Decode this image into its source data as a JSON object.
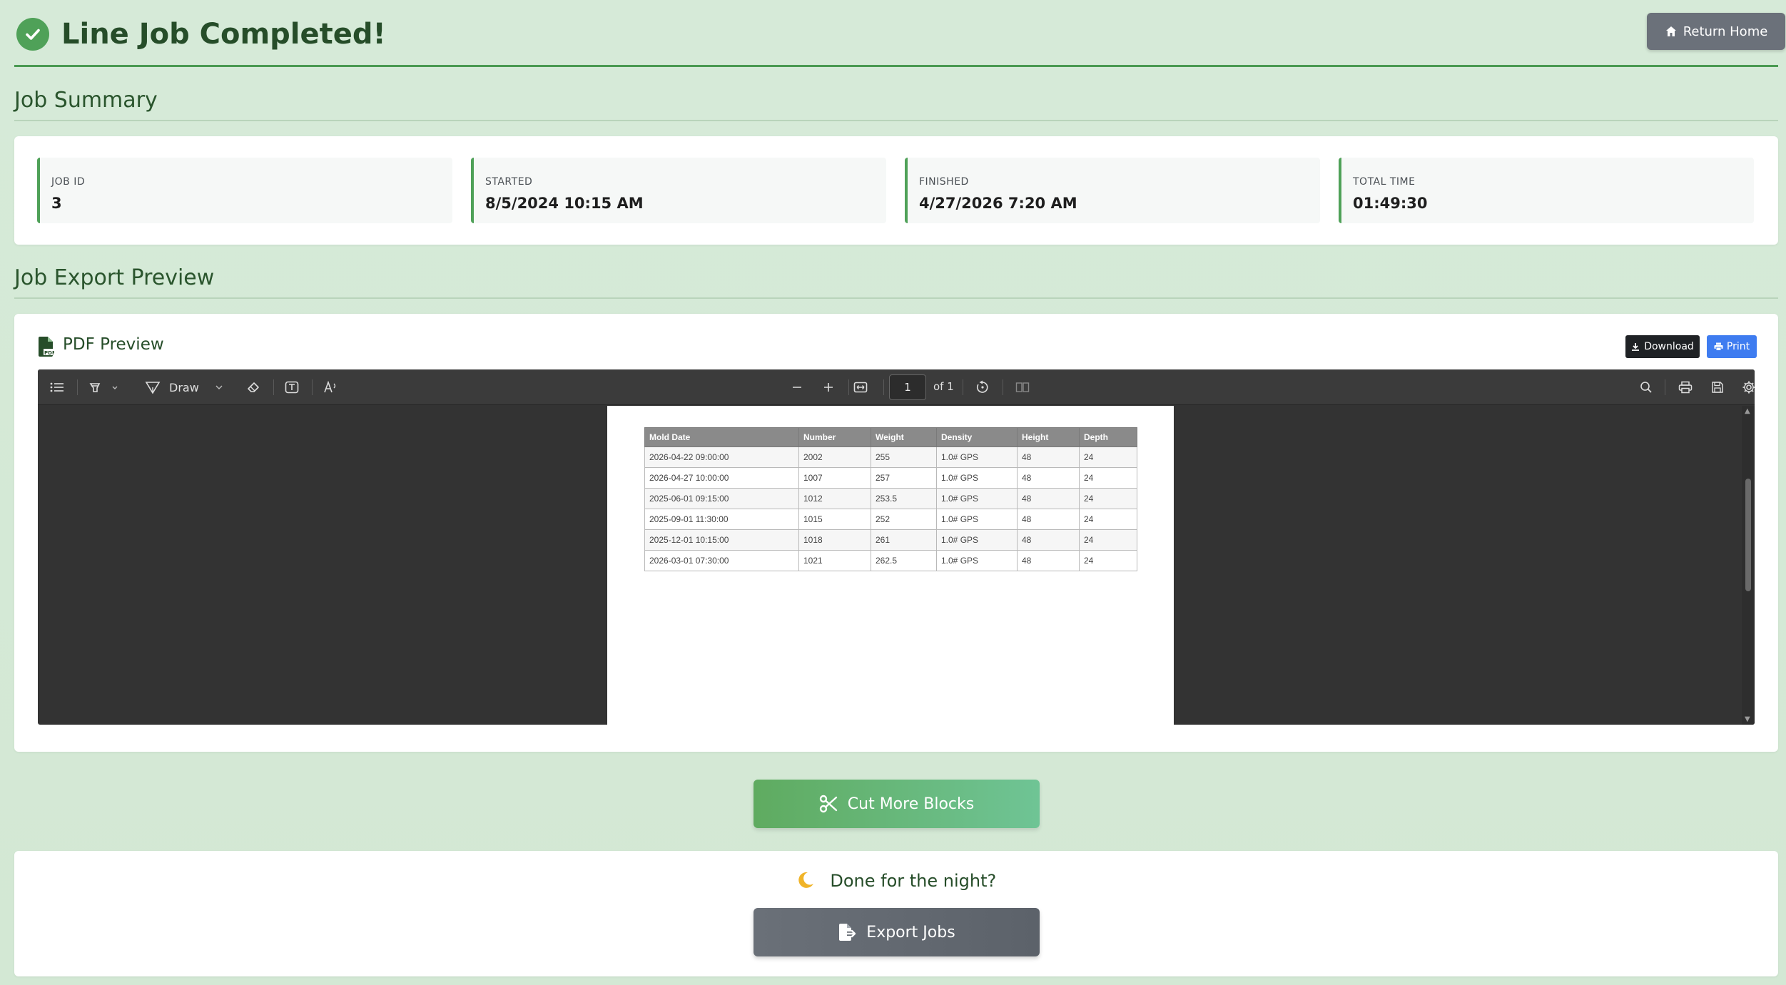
{
  "header": {
    "title": "Line Job Completed!",
    "return_label": "Return Home"
  },
  "summary": {
    "section_title": "Job Summary",
    "stats": [
      {
        "label": "JOB ID",
        "value": "3"
      },
      {
        "label": "STARTED",
        "value": "8/5/2024 10:15 AM"
      },
      {
        "label": "FINISHED",
        "value": "4/27/2026 7:20 AM"
      },
      {
        "label": "TOTAL TIME",
        "value": "01:49:30"
      }
    ]
  },
  "export": {
    "section_title": "Job Export Preview",
    "preview_title": "PDF Preview",
    "download_label": "Download",
    "print_label": "Print"
  },
  "viewer": {
    "draw_label": "Draw",
    "page_number": "1",
    "page_of": "of 1",
    "table": {
      "headers": [
        "Mold Date",
        "Number",
        "Weight",
        "Density",
        "Height",
        "Depth"
      ],
      "rows": [
        [
          "2026-04-22 09:00:00",
          "2002",
          "255",
          "1.0# GPS",
          "48",
          "24"
        ],
        [
          "2026-04-27 10:00:00",
          "1007",
          "257",
          "1.0# GPS",
          "48",
          "24"
        ],
        [
          "2025-06-01 09:15:00",
          "1012",
          "253.5",
          "1.0# GPS",
          "48",
          "24"
        ],
        [
          "2025-09-01 11:30:00",
          "1015",
          "252",
          "1.0# GPS",
          "48",
          "24"
        ],
        [
          "2025-12-01 10:15:00",
          "1018",
          "261",
          "1.0# GPS",
          "48",
          "24"
        ],
        [
          "2026-03-01 07:30:00",
          "1021",
          "262.5",
          "1.0# GPS",
          "48",
          "24"
        ]
      ]
    }
  },
  "actions": {
    "cut_more_label": "Cut More Blocks",
    "night_title": "Done for the night?",
    "export_label": "Export Jobs"
  },
  "colors": {
    "accent_green": "#4fa158",
    "title_green": "#264d29",
    "print_blue": "#3e7cf0",
    "moon": "#f0b429"
  }
}
